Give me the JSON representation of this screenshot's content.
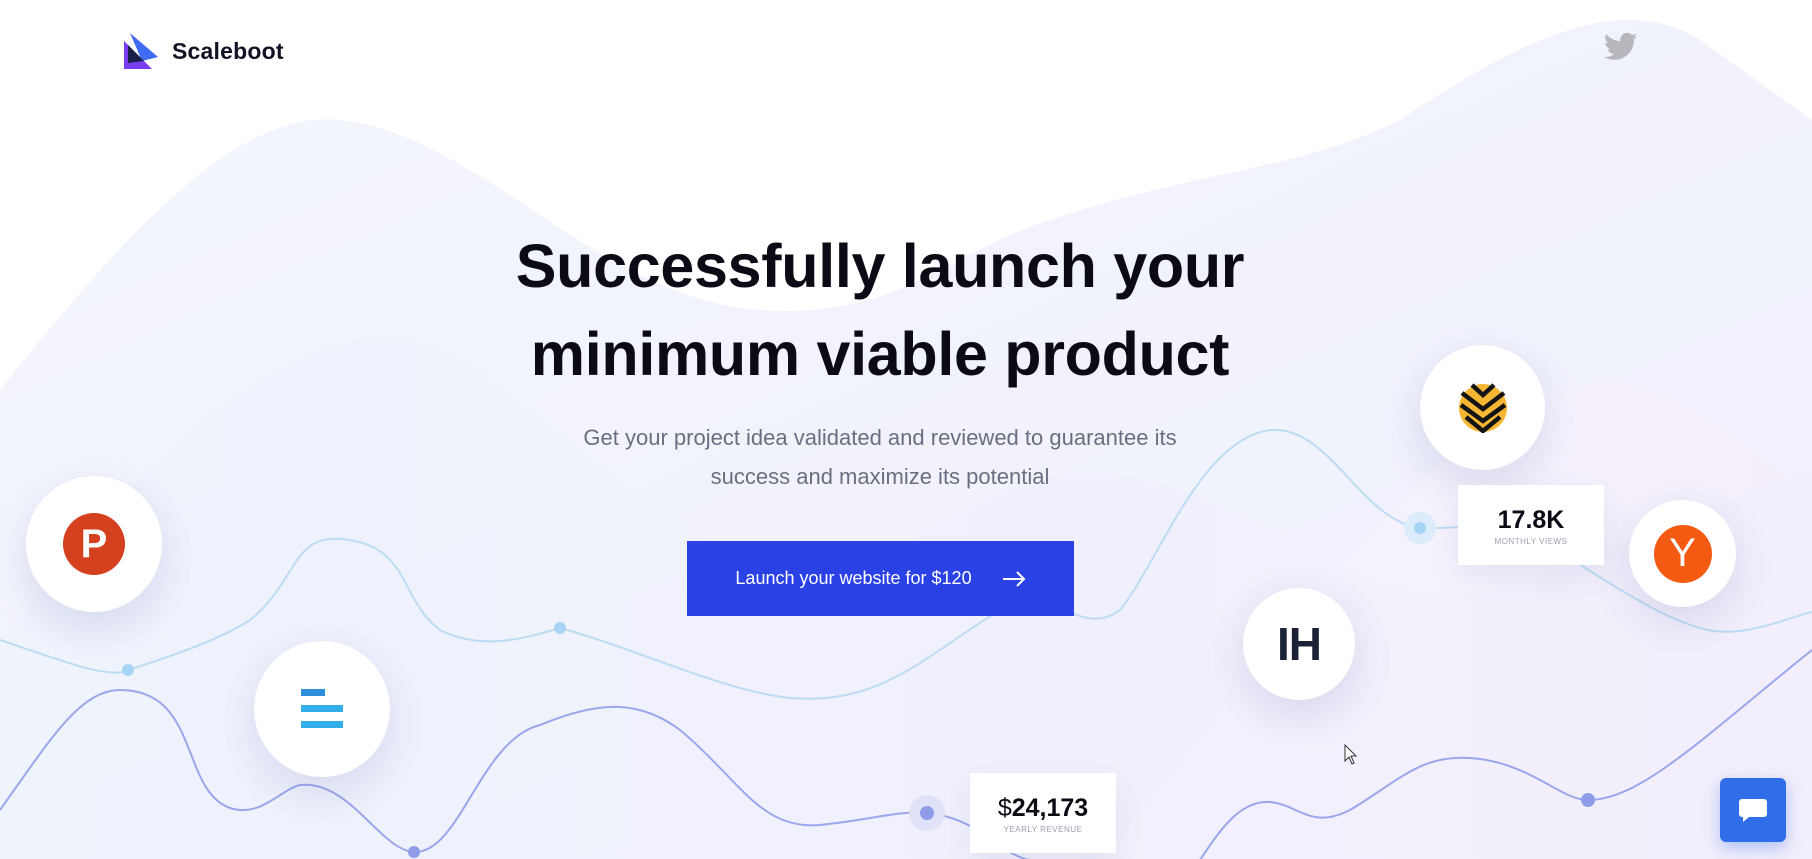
{
  "brand": {
    "name": "Scaleboot"
  },
  "hero": {
    "title_line1": "Successfully launch your",
    "title_line2": "minimum viable product",
    "subtitle_line1": "Get your project idea validated and reviewed to guarantee its",
    "subtitle_line2": "success and maximize its potential",
    "cta_label": "Launch your website for $120"
  },
  "stats": {
    "views": {
      "value": "17.8K",
      "label": "MONTHLY VIEWS"
    },
    "revenue": {
      "currency": "$",
      "value": "24,173",
      "label": "YEARLY REVENUE"
    }
  },
  "platforms": {
    "product_hunt": {
      "letter": "P",
      "icon": "product-hunt-icon"
    },
    "indie_hackers": {
      "letter": "IH",
      "icon": "indie-hackers-icon"
    },
    "hacker_news": {
      "letter": "Y",
      "icon": "y-combinator-icon"
    },
    "bars": {
      "icon": "bars-logo-icon"
    },
    "zebra": {
      "icon": "zebra-logo-icon"
    }
  },
  "icons": {
    "social": "twitter-icon",
    "chat": "chat-icon",
    "arrow": "arrow-right-icon"
  },
  "colors": {
    "accent": "#2a41e6",
    "chat": "#2f6ee8",
    "product_hunt": "#d5401f",
    "hacker_news": "#f45a12",
    "line_light": "#bcdcf4",
    "line_dark": "#9aa7ec"
  }
}
